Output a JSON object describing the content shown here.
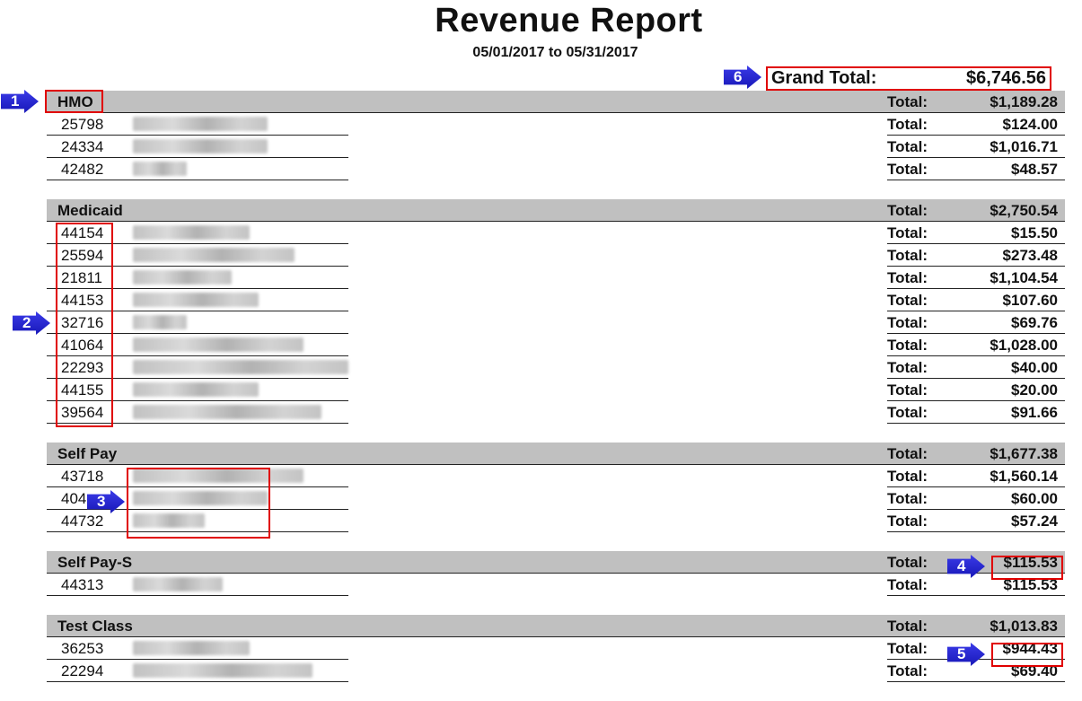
{
  "report": {
    "title": "Revenue Report",
    "date_range": "05/01/2017 to 05/31/2017",
    "grand_total_label": "Grand Total:",
    "grand_total_value": "$6,746.56",
    "total_label": "Total:"
  },
  "groups": [
    {
      "name": "HMO",
      "total": "$1,189.28",
      "rows": [
        {
          "account": "25798",
          "total": "$124.00"
        },
        {
          "account": "24334",
          "total": "$1,016.71"
        },
        {
          "account": "42482",
          "total": "$48.57"
        }
      ]
    },
    {
      "name": "Medicaid",
      "total": "$2,750.54",
      "rows": [
        {
          "account": "44154",
          "total": "$15.50"
        },
        {
          "account": "25594",
          "total": "$273.48"
        },
        {
          "account": "21811",
          "total": "$1,104.54"
        },
        {
          "account": "44153",
          "total": "$107.60"
        },
        {
          "account": "32716",
          "total": "$69.76"
        },
        {
          "account": "41064",
          "total": "$1,028.00"
        },
        {
          "account": "22293",
          "total": "$40.00"
        },
        {
          "account": "44155",
          "total": "$20.00"
        },
        {
          "account": "39564",
          "total": "$91.66"
        }
      ]
    },
    {
      "name": "Self Pay",
      "total": "$1,677.38",
      "rows": [
        {
          "account": "43718",
          "total": "$1,560.14"
        },
        {
          "account": "404",
          "total": "$60.00"
        },
        {
          "account": "44732",
          "total": "$57.24"
        }
      ]
    },
    {
      "name": "Self Pay-S",
      "total": "$115.53",
      "rows": [
        {
          "account": "44313",
          "total": "$115.53"
        }
      ]
    },
    {
      "name": "Test Class",
      "total": "$1,013.83",
      "rows": [
        {
          "account": "36253",
          "total": "$944.43"
        },
        {
          "account": "22294",
          "total": "$69.40"
        }
      ]
    }
  ],
  "callouts": [
    "1",
    "2",
    "3",
    "4",
    "5",
    "6"
  ],
  "colors": {
    "highlight": "#e00000",
    "callout": "#2222cc",
    "header_band": "#c0c0c0"
  }
}
